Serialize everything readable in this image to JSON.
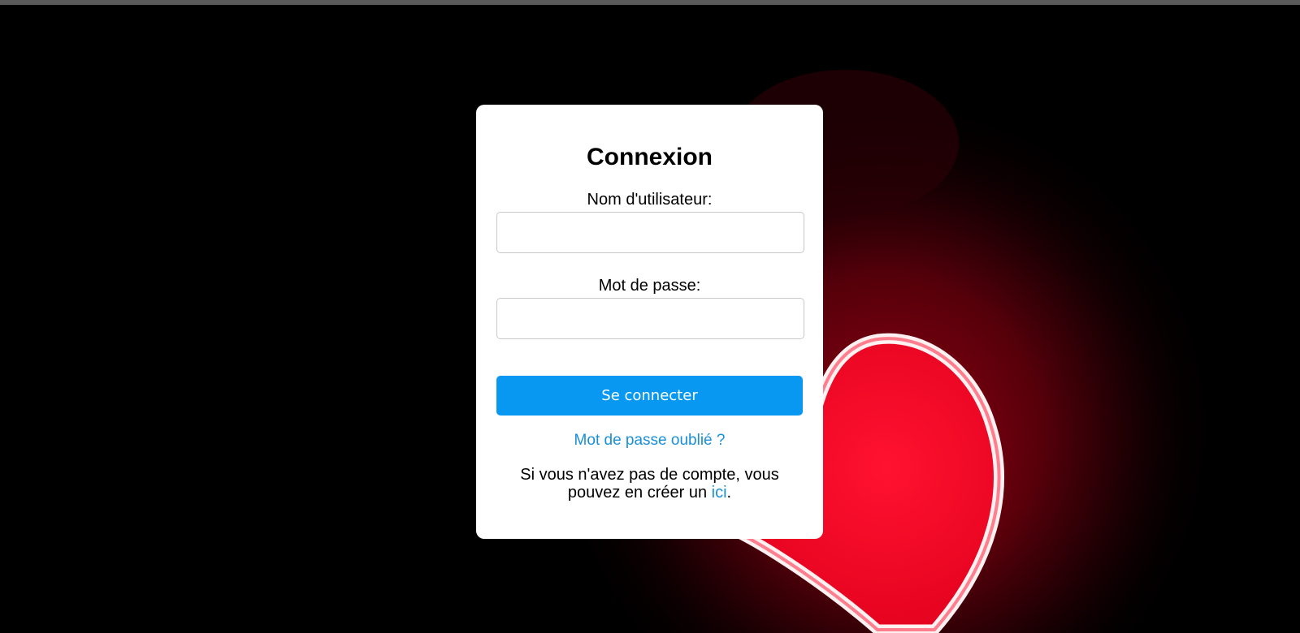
{
  "login": {
    "title": "Connexion",
    "username_label": "Nom d'utilisateur:",
    "username_value": "",
    "password_label": "Mot de passe:",
    "password_value": "",
    "submit_label": "Se connecter",
    "forgot_link": "Mot de passe oublié ?",
    "signup_text_before": "Si vous n'avez pas de compte, vous pouvez en créer un ",
    "signup_link": "ici",
    "signup_text_after": "."
  },
  "theme": {
    "accent": "#0898f2",
    "link": "#1a8fd8",
    "card_background": "#ffffff",
    "page_background": "#000000"
  },
  "background": {
    "icon": "neon-heart-photo"
  }
}
